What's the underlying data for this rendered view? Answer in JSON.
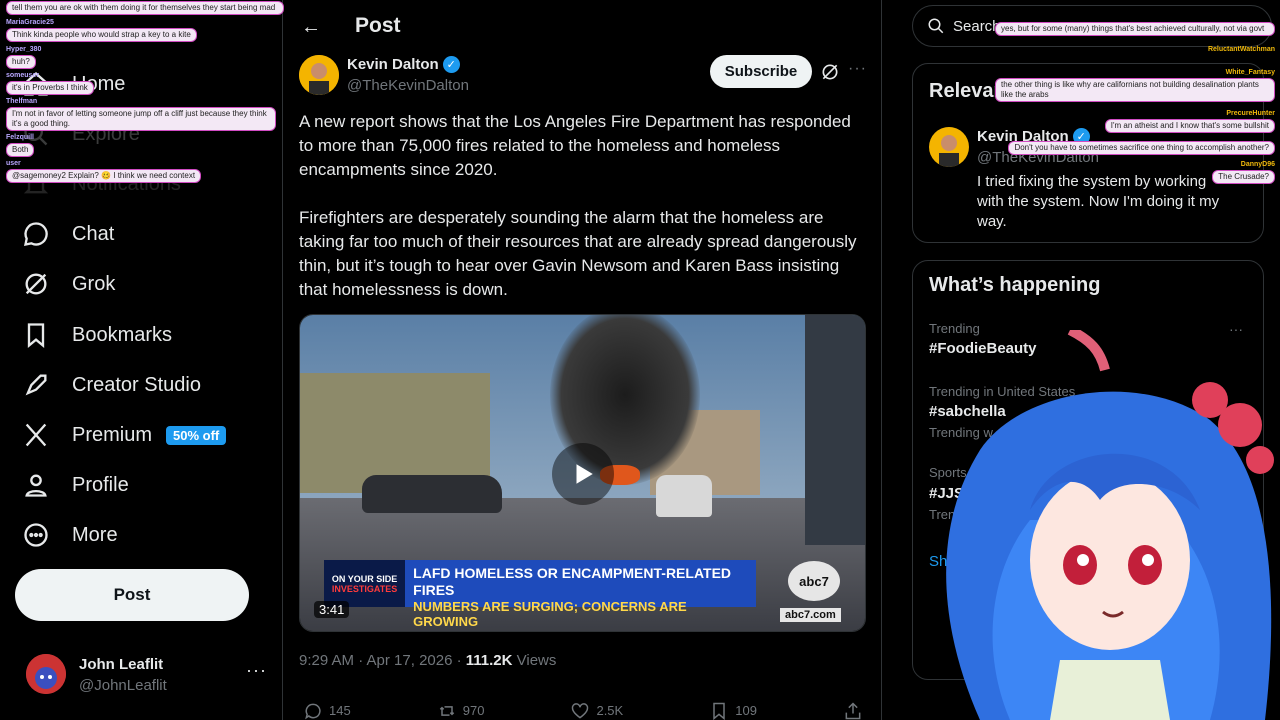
{
  "nav": {
    "items": [
      {
        "label": "Home",
        "icon": "home-icon"
      },
      {
        "label": "Explore",
        "icon": "search-icon"
      },
      {
        "label": "Notifications",
        "icon": "bell-icon"
      },
      {
        "label": "Chat",
        "icon": "chat-icon"
      },
      {
        "label": "Grok",
        "icon": "grok-icon"
      },
      {
        "label": "Bookmarks",
        "icon": "bookmark-icon"
      },
      {
        "label": "Creator Studio",
        "icon": "rocket-icon"
      },
      {
        "label": "Premium",
        "icon": "x-logo-icon",
        "badge": "50% off"
      },
      {
        "label": "Profile",
        "icon": "person-icon"
      },
      {
        "label": "More",
        "icon": "more-circle-icon"
      }
    ],
    "post_label": "Post",
    "account": {
      "name": "John Leaflit",
      "handle": "@JohnLeaflit"
    }
  },
  "chat_overlay_left": [
    {
      "user": "",
      "text": "tell them you are ok with them doing it for themselves they start being mad"
    },
    {
      "user": "MariaGracie25",
      "text": "Think kinda people who would strap a key to a kite"
    },
    {
      "user": "Hyper_380",
      "text": "huh?"
    },
    {
      "user": "someuser",
      "text": "it's in Proverbs I think"
    },
    {
      "user": "Thelfman",
      "text": "I'm not in favor of letting someone jump off a cliff just because they think it's a good thing."
    },
    {
      "user": "Felzquill",
      "text": "Both"
    },
    {
      "user": "user",
      "text": "@sagemoney2 Explain? 🥴 I think we need context"
    }
  ],
  "post": {
    "header_title": "Post",
    "author": {
      "name": "Kevin Dalton",
      "handle": "@TheKevinDalton"
    },
    "subscribe_label": "Subscribe",
    "paragraph1": "A new report shows that the Los Angeles Fire Department has responded to more than 75,000 fires related to the homeless and homeless encampments since 2020.",
    "paragraph2": "Firefighters are desperately sounding the alarm that the homeless are taking far too much of their resources that are already spread dangerously thin, but it’s tough to hear over Gavin Newsom and Karen Bass insisting that homelessness is down.",
    "video": {
      "brand_line1": "ON YOUR SIDE",
      "brand_line2": "INVESTIGATES",
      "headline": "LAFD HOMELESS OR ENCAMPMENT-RELATED FIRES",
      "subheadline": "NUMBERS ARE SURGING; CONCERNS ARE GROWING",
      "logo": "abc7",
      "url": "abc7.com",
      "duration": "3:41"
    },
    "timestamp": "9:29 AM · Apr 17, 2026 · ",
    "views_count": "111.2K",
    "views_label": " Views",
    "actions": {
      "replies": "145",
      "reposts": "970",
      "likes": "2.5K",
      "bookmarks": "109"
    }
  },
  "right": {
    "search_placeholder": "Search",
    "relevant": {
      "title": "Relevant people",
      "name": "Kevin Dalton",
      "handle": "@TheKevinDalton",
      "bio": "I tried fixing the system by working with the system. Now I'm doing it my way."
    },
    "happening": {
      "title": "What’s happening",
      "trends": [
        {
          "category": "Trending",
          "name": "#FoodieBeauty"
        },
        {
          "category": "Trending in United States",
          "name": "#sabchella",
          "extra": "Trending w"
        },
        {
          "category": "Sports · Trending",
          "name": "#JJSB",
          "extra": "Trendi"
        }
      ],
      "show_more": "Show more"
    }
  },
  "chat_overlay_right": [
    {
      "text": "yes, but for some (many) things that's best achieved culturally, not via govt"
    },
    {
      "user": "ReluctantWatchman",
      "text": ""
    },
    {
      "user": "White_Fantasy",
      "text": "the other thing is like why are californians not building desalination plants like the arabs"
    },
    {
      "user": "PrecureHunter",
      "text": "I'm an atheist and I know that's some bullshit"
    },
    {
      "user": "",
      "text": "Don't you have to sometimes sacrifice one thing to accomplish another?"
    },
    {
      "user": "DannyD96",
      "text": "The Crusade?"
    }
  ],
  "colors": {
    "accent": "#1d9bf0",
    "bg": "#000000",
    "text": "#e7e9ea",
    "muted": "#71767b"
  }
}
